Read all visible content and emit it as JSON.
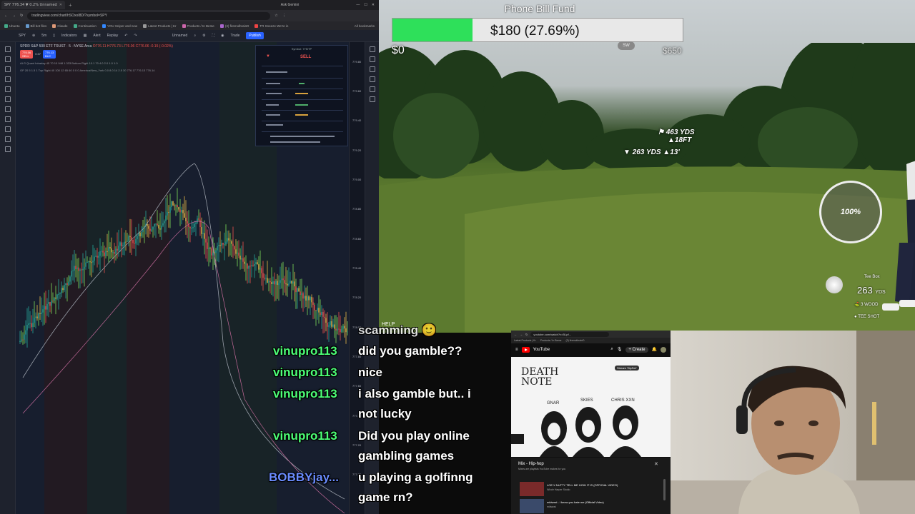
{
  "browser": {
    "tabs": [
      {
        "label": "SPY 776.34 ▼ 0.2% Unnamed"
      },
      {
        "label": "Ask Gemini"
      }
    ],
    "url": "tradingview.com/chart/hSOxoI8D/?symbol=SPY",
    "bookmarks": [
      "Ubuntu",
      "Bill bot files",
      "Claude",
      "Continuation",
      "YOU Sniper and new",
      "Latest Products | Kr",
      "Products / In Beme",
      "(3) firemolbrainD",
      "TR Sneeze We're in",
      "All bookmarks"
    ],
    "toolbar": {
      "symbol": "SPY",
      "interval": "5m",
      "indicators_label": "Indicators",
      "alert_label": "Alert",
      "replay_label": "Replay",
      "layout_label": "Unnamed",
      "trade_label": "Trade",
      "publish_label": "Publish"
    },
    "chart": {
      "title": "SPDR S&P 500 ETF TRUST · 5 · NYSE Arca",
      "ohlc": "O776.11 H776.73 L776.06 C776.06 -0.15 (-0.02%)",
      "sell_price": "776.06",
      "sell_label": "SELL",
      "buy_price": "776.13",
      "buy_label": "BUY",
      "spread": "0.07",
      "indicator_line_1": "ALG Quant Intraday 45 70 10 948 1.333 Bottom Right 10.1 70 4.0 2.0 1.0 1.0",
      "indicator_line_2": "GP 20 5 1.5 1 Top Right 40 100 12 65 60 0 0 0 America/New_York 0.0 8.0 14 2.5 30 776.17 776.13 776.14",
      "price_scale": [
        "779.80",
        "779.60",
        "779.40",
        "779.20",
        "779.00",
        "778.80",
        "778.60",
        "778.40",
        "778.20",
        "778.00",
        "777.80",
        "777.60",
        "777.40",
        "777.20",
        "777.00"
      ],
      "signal_panel": {
        "header": "Symbol: 775/TP",
        "signal": "SELL"
      }
    }
  },
  "game": {
    "fund": {
      "title": "Phone Bill Fund",
      "current": "$180 (27.69%)",
      "progress": 0.2769,
      "min_label": "$0",
      "max_label": "$650"
    },
    "distance_pin": "463 YDS",
    "elevation": "▲18FT",
    "target": "263 YDS ▲13'",
    "power": "100%",
    "hole_label": "Tee Box",
    "shot_distance": "263",
    "shot_unit": "YDS",
    "club": "3 WOOD",
    "shot_type": "TEE SHOT",
    "help_label": "HELP",
    "sw_label": "SW"
  },
  "chat": [
    {
      "user": "",
      "lines": [
        "scamming 🙂"
      ]
    },
    {
      "user": "vinupro113",
      "lines": [
        "did you gamble??"
      ]
    },
    {
      "user": "vinupro113",
      "lines": [
        "nice"
      ]
    },
    {
      "user": "vinupro113",
      "lines": [
        "i also gamble but.. i",
        "not lucky"
      ]
    },
    {
      "user": "vinupro113",
      "lines": [
        "Did you play online",
        "gambling games"
      ]
    },
    {
      "user": "BOBBYjay...",
      "lines": [
        "u playing a golfinng",
        "game rn?"
      ]
    }
  ],
  "youtube": {
    "url": "youtube.com/watch?v=BLpf...",
    "brand": "YouTube",
    "create_label": "+ Create",
    "album_title": "DEATH NOTE",
    "artists": [
      "GNAR",
      "SKIES",
      "CHRIS XXN"
    ],
    "mix_title": "Mix - Hip-hop",
    "mix_subtitle": "Mixes are playlists YouTube makes for you",
    "items": [
      {
        "title": "LOE X NUTTY TELL ME HOW IT IS (OFFICIAL VIDEO)",
        "channel": "Whole Harper Studio"
      },
      {
        "title": "midwxst - i know you hate me (Official Video)",
        "channel": "midwxst"
      }
    ],
    "playlist_badge": "Stream 'DipSet'"
  },
  "colors": {
    "fund_fill": "#2ee05a",
    "chat_username": "#4dff78",
    "tv_bg": "#131722",
    "sell_red": "#ef5350",
    "buy_green": "#26a69a"
  }
}
